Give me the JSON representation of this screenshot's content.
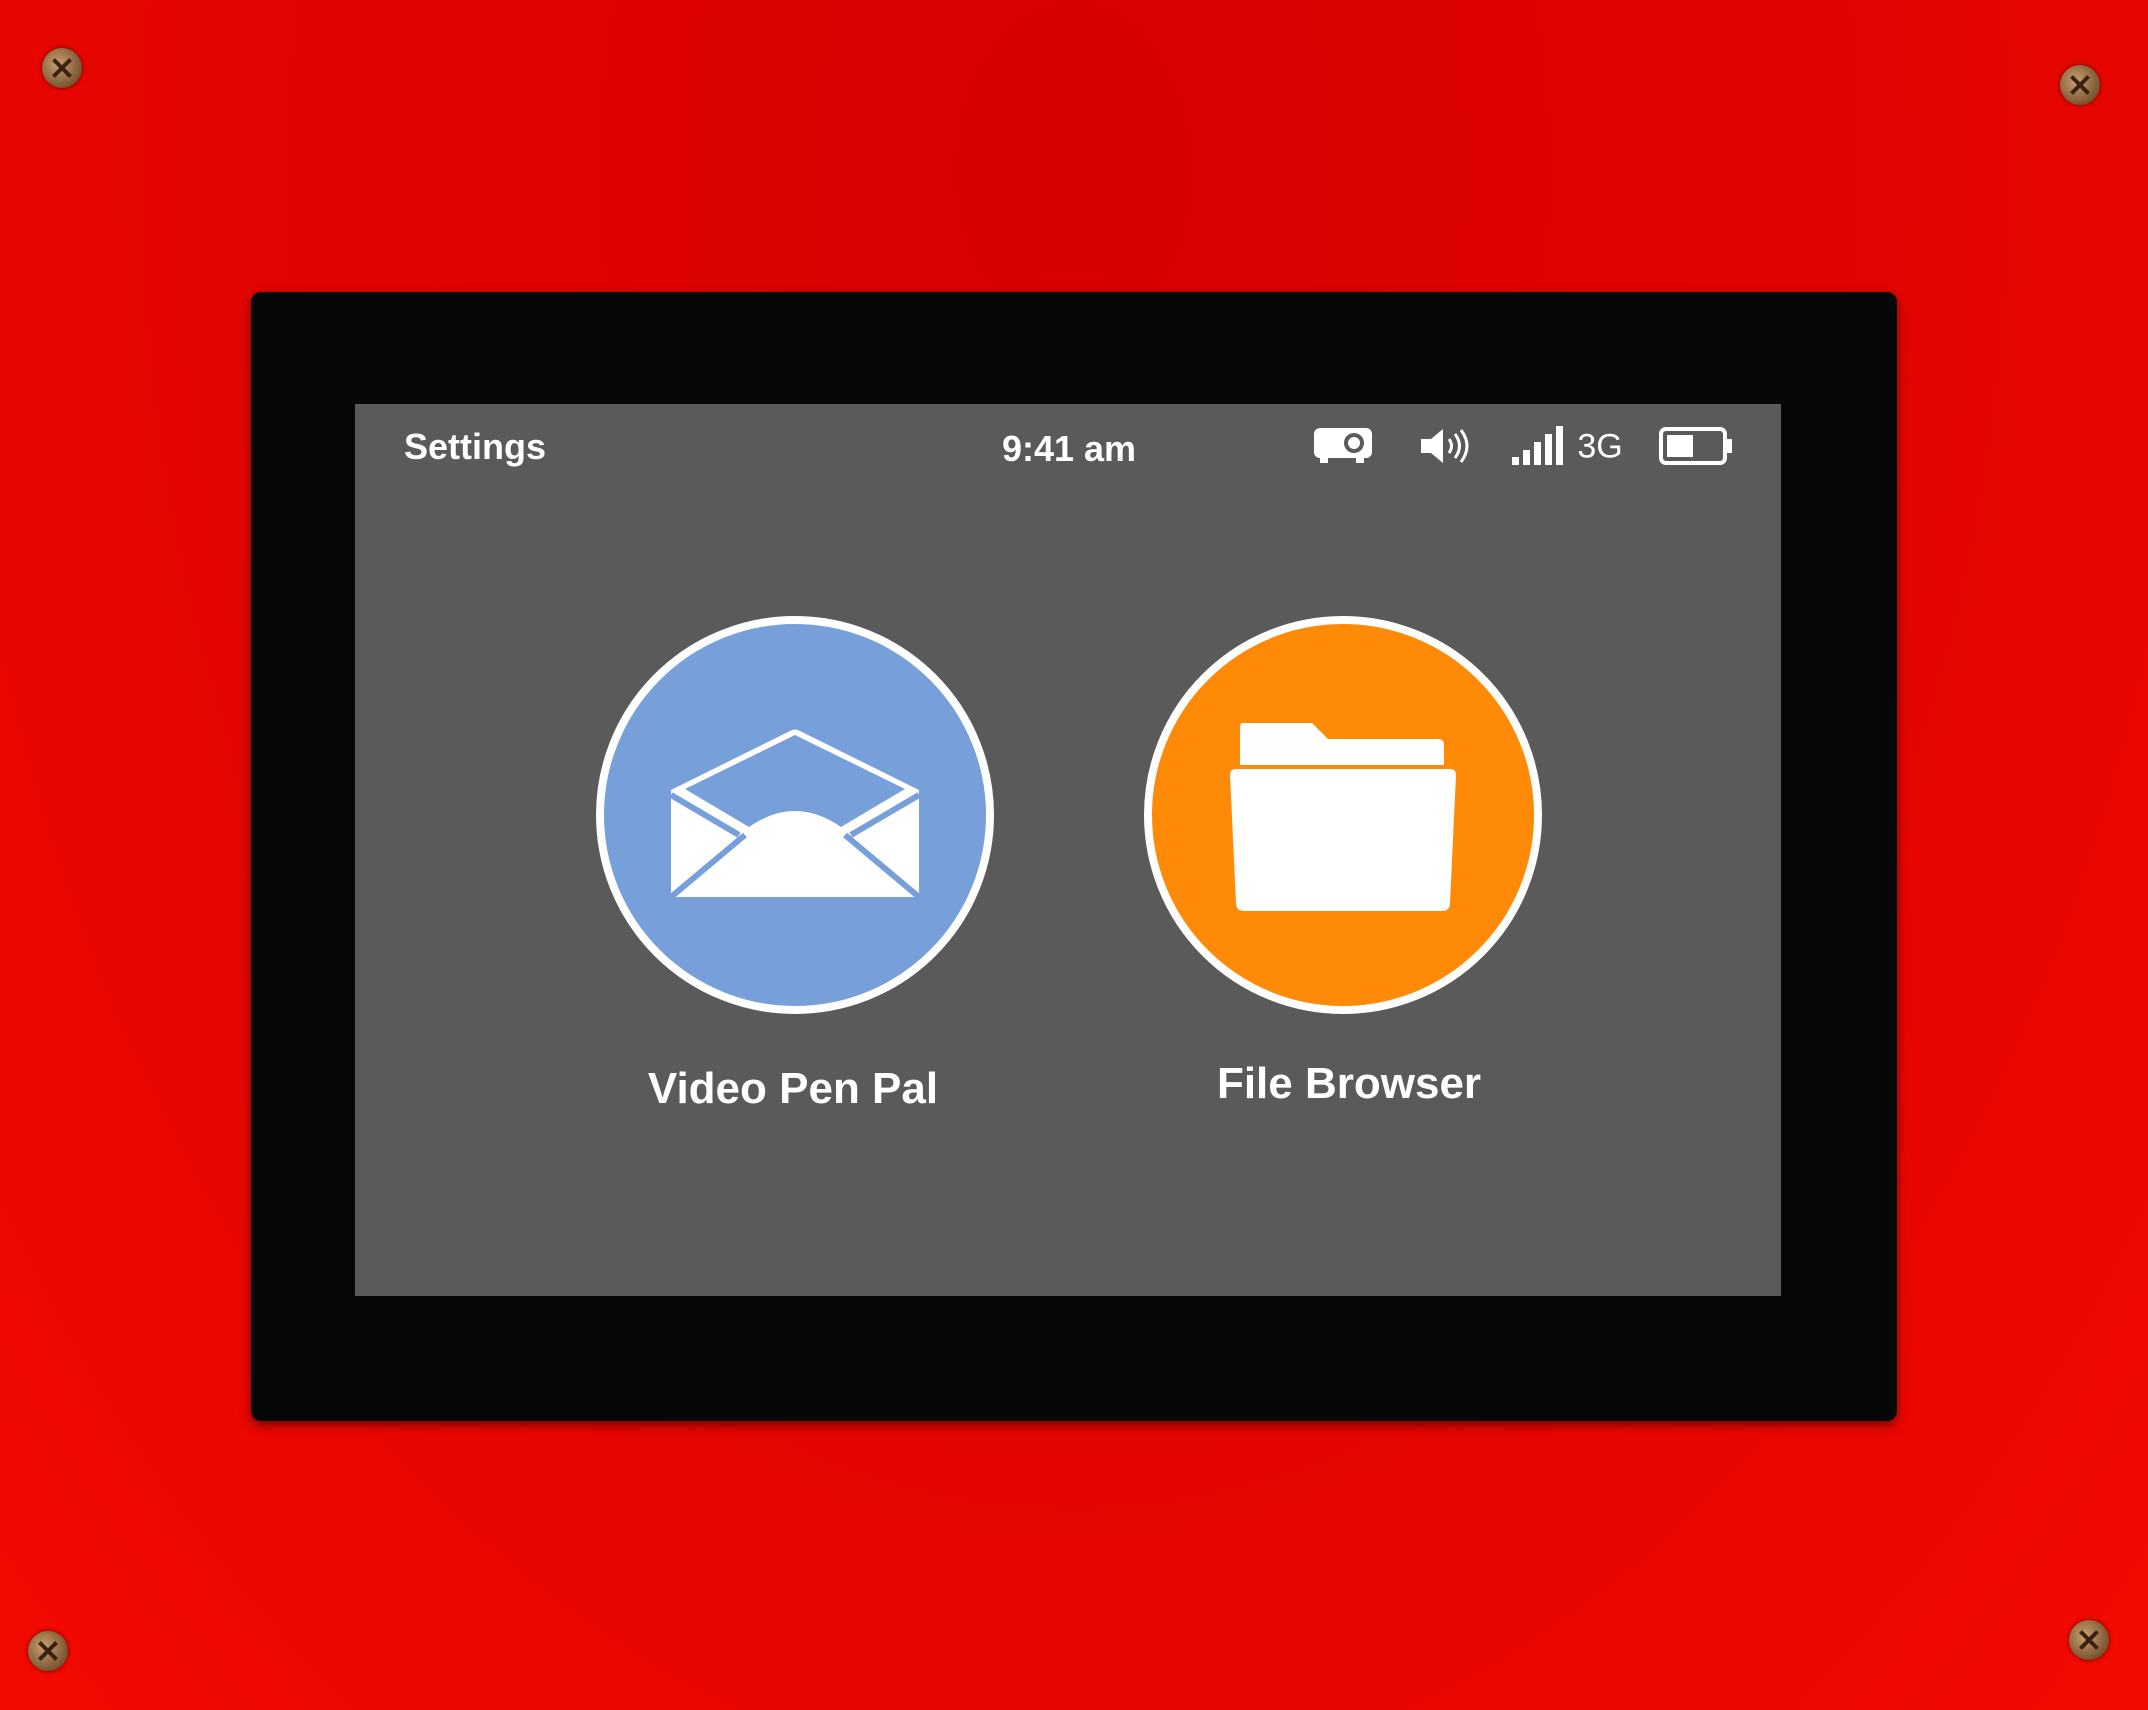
{
  "status_bar": {
    "settings_label": "Settings",
    "time": "9:41 am",
    "network": "3G",
    "icons": [
      "projector-icon",
      "speaker-volume-icon",
      "signal-strength-icon",
      "battery-icon"
    ],
    "battery_level_percent": 50
  },
  "apps": [
    {
      "label": "Video Pen Pal",
      "icon": "open-envelope-icon",
      "color": "#779FD9"
    },
    {
      "label": "File Browser",
      "icon": "folder-icon",
      "color": "#FF8A07"
    }
  ]
}
